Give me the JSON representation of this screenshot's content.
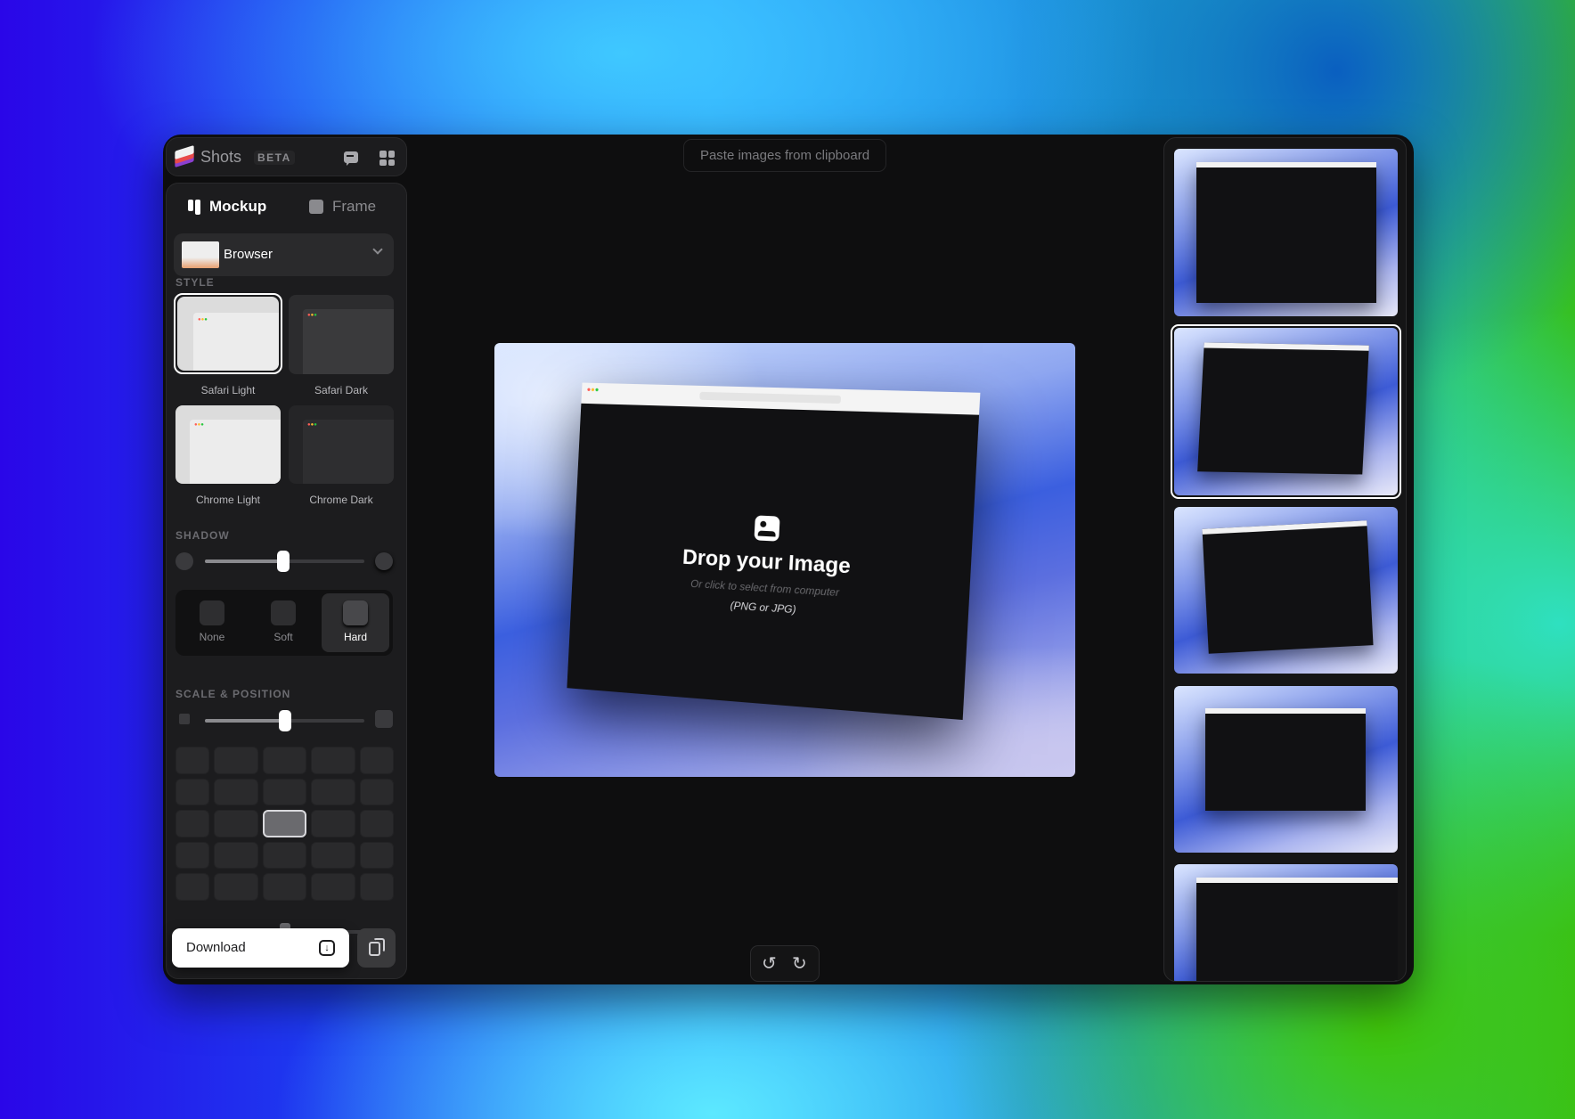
{
  "app": {
    "name": "Shots",
    "badge": "BETA"
  },
  "header": {
    "feedback_icon": "chat-icon",
    "apps_icon": "grid-icon"
  },
  "tabs": [
    {
      "label": "Mockup",
      "icon": "mockup-icon",
      "active": true
    },
    {
      "label": "Frame",
      "icon": "image-icon",
      "active": false
    }
  ],
  "mockup_select": {
    "value": "Browser"
  },
  "style": {
    "label": "STYLE",
    "options": [
      {
        "label": "Safari Light",
        "selected": true
      },
      {
        "label": "Safari Dark"
      },
      {
        "label": "Chrome Light"
      },
      {
        "label": "Chrome Dark"
      }
    ]
  },
  "shadow": {
    "label": "SHADOW",
    "slider_percent": 49,
    "options": [
      {
        "label": "None"
      },
      {
        "label": "Soft"
      },
      {
        "label": "Hard",
        "selected": true
      }
    ]
  },
  "scale": {
    "label": "SCALE & POSITION",
    "slider_percent": 50,
    "grid_rows": 5,
    "grid_cols": 5,
    "selected_cell": [
      2,
      2
    ]
  },
  "footer": {
    "download_label": "Download",
    "download_icon": "download-icon",
    "copy_icon": "copy-icon"
  },
  "canvas": {
    "paste_hint": "Paste images from clipboard",
    "drop_title": "Drop your Image",
    "drop_subtitle": "Or click to select from computer",
    "drop_formats": "(PNG or JPG)"
  },
  "history": {
    "undo_icon": "undo-icon",
    "redo_icon": "redo-icon"
  },
  "presets": {
    "count": 5,
    "selected": 1
  }
}
